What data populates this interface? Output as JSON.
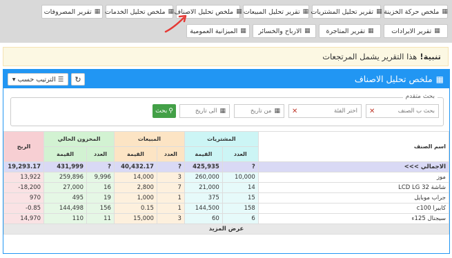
{
  "tabs_row1": [
    {
      "label": "ملخص حركة الخزينة",
      "id": "tab-treasury"
    },
    {
      "label": "تقرير تحليل المشتريات",
      "id": "tab-purchases"
    },
    {
      "label": "تقرير تحليل المبيعات",
      "id": "tab-sales"
    },
    {
      "label": "ملخص تحليل الاصناف",
      "id": "tab-items"
    },
    {
      "label": "ملخص تحليل الخدمات",
      "id": "tab-services"
    },
    {
      "label": "تقرير المصروفات",
      "id": "tab-expenses"
    }
  ],
  "tabs_row2": [
    {
      "label": "تقرير الايرادات",
      "id": "tab-revenue"
    },
    {
      "label": "تقرير المتاجرة",
      "id": "tab-trading"
    },
    {
      "label": "الارباح والخسائر",
      "id": "tab-profit-loss"
    },
    {
      "label": "الميزانية العمومية",
      "id": "tab-balance"
    }
  ],
  "alert": {
    "strong": "تنبية!",
    "text": "هذا التقرير يشمل المرتجعات"
  },
  "panel": {
    "title": "ملخص تحليل الاصناف",
    "sort_label": "الترتيب حسب"
  },
  "filters": {
    "legend": "بحث متقدم",
    "item_placeholder": "بحث ب الصنف",
    "category_placeholder": "اختر الفئة",
    "from_date_placeholder": "من تاريخ",
    "to_date_placeholder": "الى تاريخ",
    "search_label": "بحث"
  },
  "table": {
    "col_item": "اسم الصنف",
    "grp_purchases": "المشتريات",
    "grp_sales": "المبيعات",
    "grp_stock": "المخزون الحالي",
    "col_profit": "الربح",
    "sub_count": "العدد",
    "sub_value": "القيمة",
    "total": {
      "name": "الاجمالي >>>",
      "buy_count": "?",
      "buy_value": "425,935",
      "sell_count": "?",
      "sell_value": "40,432.17",
      "stock_count": "?",
      "stock_value": "431,999",
      "profit": "19,293.17"
    },
    "rows": [
      {
        "name": "موز",
        "buy_count": "10,000",
        "buy_value": "260,000",
        "sell_count": "3",
        "sell_value": "14,000",
        "stock_count": "9,996",
        "stock_value": "259,896",
        "profit": "13,922"
      },
      {
        "name": "شاشة LCD LG 32",
        "buy_count": "14",
        "buy_value": "21,000",
        "sell_count": "7",
        "sell_value": "2,800",
        "stock_count": "16",
        "stock_value": "27,000",
        "profit": "-18,200"
      },
      {
        "name": "جراب موبايل",
        "buy_count": "15",
        "buy_value": "375",
        "sell_count": "1",
        "sell_value": "1,000",
        "stock_count": "19",
        "stock_value": "495",
        "profit": "970"
      },
      {
        "name": "كابيرا c100",
        "buy_count": "158",
        "buy_value": "144,500",
        "sell_count": "1",
        "sell_value": "0.15",
        "stock_count": "156",
        "stock_value": "144,498",
        "profit": "-0.85"
      },
      {
        "name": "سيجنال 125ء",
        "buy_count": "6",
        "buy_value": "60",
        "sell_count": "3",
        "sell_value": "15,000",
        "stock_count": "11",
        "stock_value": "110",
        "profit": "14,970"
      }
    ],
    "more_label": "عرض المزيد"
  }
}
